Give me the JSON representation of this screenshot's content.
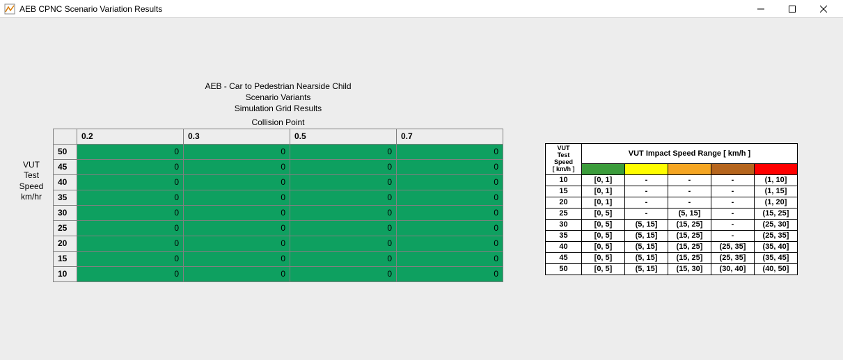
{
  "window": {
    "title": "AEB CPNC Scenario Variation Results"
  },
  "chart_data": {
    "type": "table",
    "title_lines": [
      "AEB - Car to Pedestrian Nearside Child",
      "Scenario Variants",
      "Simulation Grid Results"
    ],
    "xlabel": "Collision Point",
    "ylabel_lines": [
      "VUT",
      "Test Speed",
      "km/hr"
    ],
    "col_headers": [
      "0.2",
      "0.3",
      "0.5",
      "0.7"
    ],
    "row_headers": [
      "50",
      "45",
      "40",
      "35",
      "30",
      "25",
      "20",
      "15",
      "10"
    ],
    "cells": [
      [
        "0",
        "0",
        "0",
        "0"
      ],
      [
        "0",
        "0",
        "0",
        "0"
      ],
      [
        "0",
        "0",
        "0",
        "0"
      ],
      [
        "0",
        "0",
        "0",
        "0"
      ],
      [
        "0",
        "0",
        "0",
        "0"
      ],
      [
        "0",
        "0",
        "0",
        "0"
      ],
      [
        "0",
        "0",
        "0",
        "0"
      ],
      [
        "0",
        "0",
        "0",
        "0"
      ],
      [
        "0",
        "0",
        "0",
        "0"
      ]
    ]
  },
  "legend": {
    "row_header_label_lines": [
      "VUT",
      "Test",
      "Speed",
      "[ km/h ]"
    ],
    "col_header": "VUT Impact Speed Range [ km/h ]",
    "swatch_colors": [
      "green",
      "yellow",
      "orange",
      "brown",
      "red"
    ],
    "rows": [
      {
        "speed": "10",
        "cells": [
          "[0, 1]",
          "-",
          "-",
          "-",
          "(1, 10]"
        ]
      },
      {
        "speed": "15",
        "cells": [
          "[0, 1]",
          "-",
          "-",
          "-",
          "(1, 15]"
        ]
      },
      {
        "speed": "20",
        "cells": [
          "[0, 1]",
          "-",
          "-",
          "-",
          "(1, 20]"
        ]
      },
      {
        "speed": "25",
        "cells": [
          "[0, 5]",
          "-",
          "(5, 15]",
          "-",
          "(15, 25]"
        ]
      },
      {
        "speed": "30",
        "cells": [
          "[0, 5]",
          "(5, 15]",
          "(15, 25]",
          "-",
          "(25, 30]"
        ]
      },
      {
        "speed": "35",
        "cells": [
          "[0, 5]",
          "(5, 15]",
          "(15, 25]",
          "-",
          "(25, 35]"
        ]
      },
      {
        "speed": "40",
        "cells": [
          "[0, 5]",
          "(5, 15]",
          "(15, 25]",
          "(25, 35]",
          "(35, 40]"
        ]
      },
      {
        "speed": "45",
        "cells": [
          "[0, 5]",
          "(5, 15]",
          "(15, 25]",
          "(25, 35]",
          "(35, 45]"
        ]
      },
      {
        "speed": "50",
        "cells": [
          "[0,  5]",
          "(5, 15]",
          "(15, 30]",
          "(30, 40]",
          "(40, 50]"
        ]
      }
    ]
  }
}
